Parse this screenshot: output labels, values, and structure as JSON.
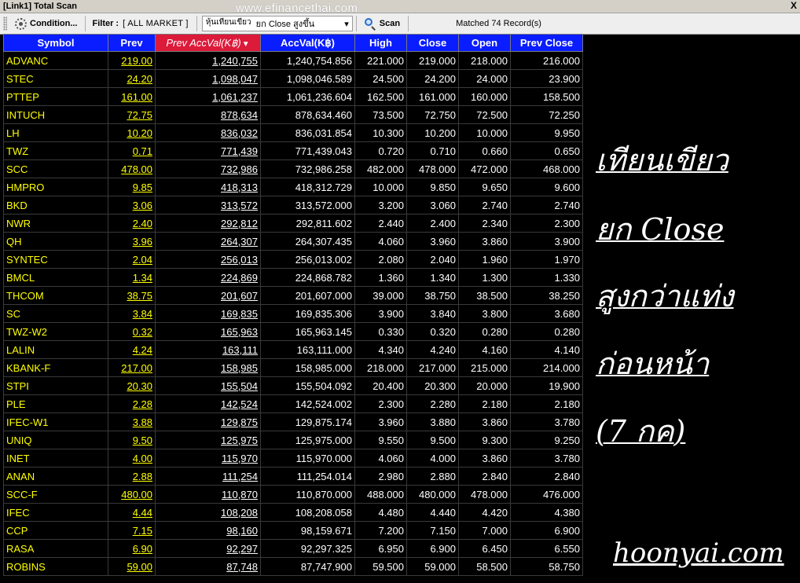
{
  "window": {
    "title": "[Link1] Total Scan",
    "close_glyph": "X"
  },
  "watermark": "www.efinancethai.com",
  "toolbar": {
    "condition_label": "Condition...",
    "filter_label": "Filter :",
    "filter_value": "[ ALL MARKET ]",
    "scan_condition_prefix": "หุ้นเทียนเขียว",
    "scan_condition_value": "ยก Close สูงขึ้น",
    "scan_label": "Scan",
    "matched_text": "Matched 74 Record(s)"
  },
  "table": {
    "columns": [
      "Symbol",
      "Prev",
      "Prev AccVal(K฿)",
      "AccVal(K฿)",
      "High",
      "Close",
      "Open",
      "Prev Close"
    ],
    "sort_arrow": "▼",
    "rows": [
      [
        "ADVANC",
        "219.00",
        "1,240,755",
        "1,240,754.856",
        "221.000",
        "219.000",
        "218.000",
        "216.000"
      ],
      [
        "STEC",
        "24.20",
        "1,098,047",
        "1,098,046.589",
        "24.500",
        "24.200",
        "24.000",
        "23.900"
      ],
      [
        "PTTEP",
        "161.00",
        "1,061,237",
        "1,061,236.604",
        "162.500",
        "161.000",
        "160.000",
        "158.500"
      ],
      [
        "INTUCH",
        "72.75",
        "878,634",
        "878,634.460",
        "73.500",
        "72.750",
        "72.500",
        "72.250"
      ],
      [
        "LH",
        "10.20",
        "836,032",
        "836,031.854",
        "10.300",
        "10.200",
        "10.000",
        "9.950"
      ],
      [
        "TWZ",
        "0.71",
        "771,439",
        "771,439.043",
        "0.720",
        "0.710",
        "0.660",
        "0.650"
      ],
      [
        "SCC",
        "478.00",
        "732,986",
        "732,986.258",
        "482.000",
        "478.000",
        "472.000",
        "468.000"
      ],
      [
        "HMPRO",
        "9.85",
        "418,313",
        "418,312.729",
        "10.000",
        "9.850",
        "9.650",
        "9.600"
      ],
      [
        "BKD",
        "3.06",
        "313,572",
        "313,572.000",
        "3.200",
        "3.060",
        "2.740",
        "2.740"
      ],
      [
        "NWR",
        "2.40",
        "292,812",
        "292,811.602",
        "2.440",
        "2.400",
        "2.340",
        "2.300"
      ],
      [
        "QH",
        "3.96",
        "264,307",
        "264,307.435",
        "4.060",
        "3.960",
        "3.860",
        "3.900"
      ],
      [
        "SYNTEC",
        "2.04",
        "256,013",
        "256,013.002",
        "2.080",
        "2.040",
        "1.960",
        "1.970"
      ],
      [
        "BMCL",
        "1.34",
        "224,869",
        "224,868.782",
        "1.360",
        "1.340",
        "1.300",
        "1.330"
      ],
      [
        "THCOM",
        "38.75",
        "201,607",
        "201,607.000",
        "39.000",
        "38.750",
        "38.500",
        "38.250"
      ],
      [
        "SC",
        "3.84",
        "169,835",
        "169,835.306",
        "3.900",
        "3.840",
        "3.800",
        "3.680"
      ],
      [
        "TWZ-W2",
        "0.32",
        "165,963",
        "165,963.145",
        "0.330",
        "0.320",
        "0.280",
        "0.280"
      ],
      [
        "LALIN",
        "4.24",
        "163,111",
        "163,111.000",
        "4.340",
        "4.240",
        "4.160",
        "4.140"
      ],
      [
        "KBANK-F",
        "217.00",
        "158,985",
        "158,985.000",
        "218.000",
        "217.000",
        "215.000",
        "214.000"
      ],
      [
        "STPI",
        "20.30",
        "155,504",
        "155,504.092",
        "20.400",
        "20.300",
        "20.000",
        "19.900"
      ],
      [
        "PLE",
        "2.28",
        "142,524",
        "142,524.002",
        "2.300",
        "2.280",
        "2.180",
        "2.180"
      ],
      [
        "IFEC-W1",
        "3.88",
        "129,875",
        "129,875.174",
        "3.960",
        "3.880",
        "3.860",
        "3.780"
      ],
      [
        "UNIQ",
        "9.50",
        "125,975",
        "125,975.000",
        "9.550",
        "9.500",
        "9.300",
        "9.250"
      ],
      [
        "INET",
        "4.00",
        "115,970",
        "115,970.000",
        "4.060",
        "4.000",
        "3.860",
        "3.780"
      ],
      [
        "ANAN",
        "2.88",
        "111,254",
        "111,254.014",
        "2.980",
        "2.880",
        "2.840",
        "2.840"
      ],
      [
        "SCC-F",
        "480.00",
        "110,870",
        "110,870.000",
        "488.000",
        "480.000",
        "478.000",
        "476.000"
      ],
      [
        "IFEC",
        "4.44",
        "108,208",
        "108,208.058",
        "4.480",
        "4.440",
        "4.420",
        "4.380"
      ],
      [
        "CCP",
        "7.15",
        "98,160",
        "98,159.671",
        "7.200",
        "7.150",
        "7.000",
        "6.900"
      ],
      [
        "RASA",
        "6.90",
        "92,297",
        "92,297.325",
        "6.950",
        "6.900",
        "6.450",
        "6.550"
      ],
      [
        "ROBINS",
        "59.00",
        "87,748",
        "87,747.900",
        "59.500",
        "59.000",
        "58.500",
        "58.750"
      ]
    ]
  },
  "annotation": {
    "lines": [
      "เทียนเขียว",
      "ยก Close",
      "สูงกว่าแท่ง",
      "ก่อนหน้า",
      "(7 กค)"
    ],
    "site": "hoonyai.com"
  },
  "colors": {
    "header_blue": "#0a1dff",
    "header_sorted_red": "#dc1a3a",
    "symbol_yellow": "#ffff00",
    "background": "#000000"
  },
  "icons": {
    "condition": "gear-icon",
    "scan": "magnifier-icon"
  }
}
